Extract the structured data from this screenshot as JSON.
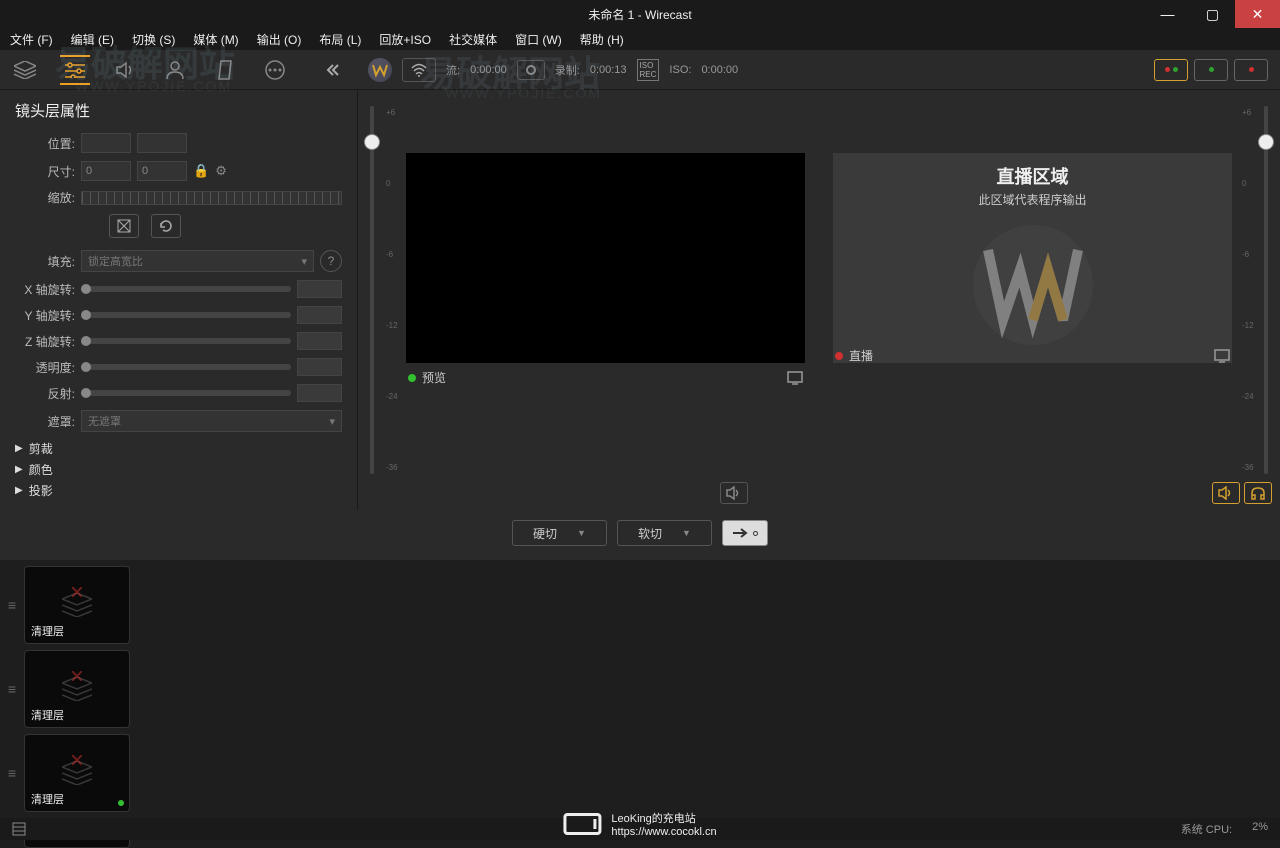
{
  "title": "未命名 1 - Wirecast",
  "menu": [
    "文件 (F)",
    "编辑 (E)",
    "切换 (S)",
    "媒体 (M)",
    "输出 (O)",
    "布局 (L)",
    "回放+ISO",
    "社交媒体",
    "窗口 (W)",
    "帮助 (H)"
  ],
  "toolbar": {
    "stream_label": "流:",
    "stream_time": "0:00:00",
    "record_label": "录制:",
    "record_time": "0:00:13",
    "iso_label": "ISO:",
    "iso_time": "0:00:00"
  },
  "panel": {
    "title": "镜头层属性",
    "position": "位置:",
    "size": "尺寸:",
    "size_w": "0",
    "size_h": "0",
    "scale": "缩放:",
    "fill": "填充:",
    "fill_value": "锁定高宽比",
    "xrot": "X 轴旋转:",
    "yrot": "Y 轴旋转:",
    "zrot": "Z 轴旋转:",
    "opacity": "透明度:",
    "reflect": "反射:",
    "mask": "遮罩:",
    "mask_value": "无遮罩",
    "crop": "剪裁",
    "color": "颜色",
    "shadow": "投影"
  },
  "preview": {
    "preview_label": "预览",
    "live_label": "直播",
    "live_title": "直播区域",
    "live_sub": "此区域代表程序输出"
  },
  "vu_scale": [
    "+6",
    "0",
    "-6",
    "-12",
    "-24",
    "-36"
  ],
  "transition": {
    "cut": "硬切",
    "smooth": "软切"
  },
  "shot": {
    "clear": "清理层"
  },
  "status": {
    "cpu_label": "系统 CPU:",
    "cpu_value": "2%"
  },
  "watermark": {
    "line1": "LeoKing的充电站",
    "line2": "https://www.cocokl.cn",
    "bg": "易破解网站",
    "bgsub": "WWW.YPOJIE.COM"
  }
}
